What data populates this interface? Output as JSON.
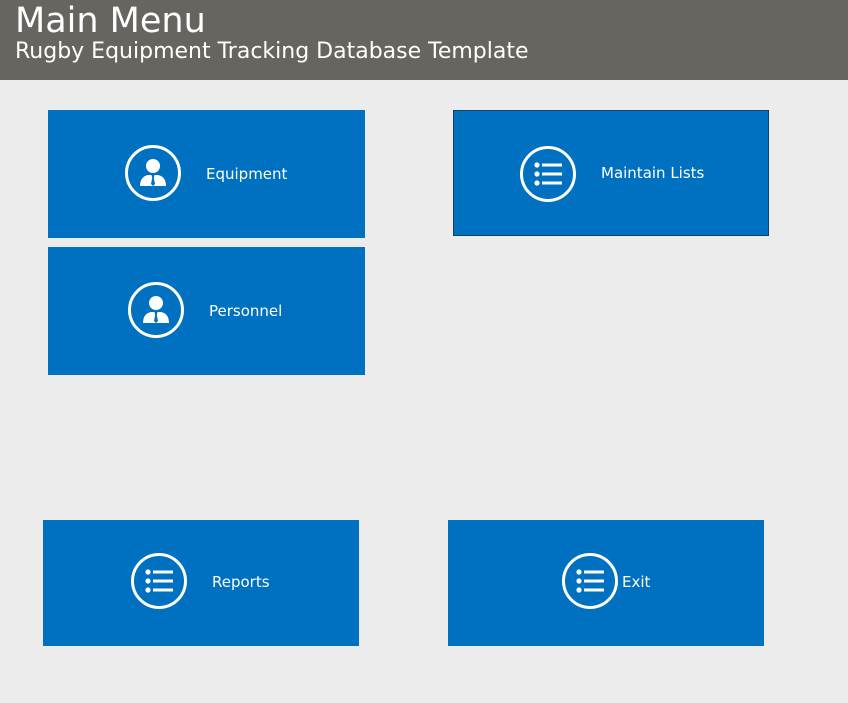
{
  "header": {
    "title": "Main Menu",
    "subtitle": "Rugby Equipment Tracking Database Template",
    "background": "#68645f"
  },
  "tiles": {
    "equipment": {
      "label": "Equipment",
      "icon": "person-icon"
    },
    "maintain_lists": {
      "label": "Maintain Lists",
      "icon": "list-icon"
    },
    "personnel": {
      "label": "Personnel",
      "icon": "person-icon"
    },
    "reports": {
      "label": "Reports",
      "icon": "list-icon"
    },
    "exit": {
      "label": "Exit",
      "icon": "list-icon"
    }
  },
  "colors": {
    "tile": "#0070c0",
    "page_background": "#ececec",
    "text": "#ffffff"
  }
}
